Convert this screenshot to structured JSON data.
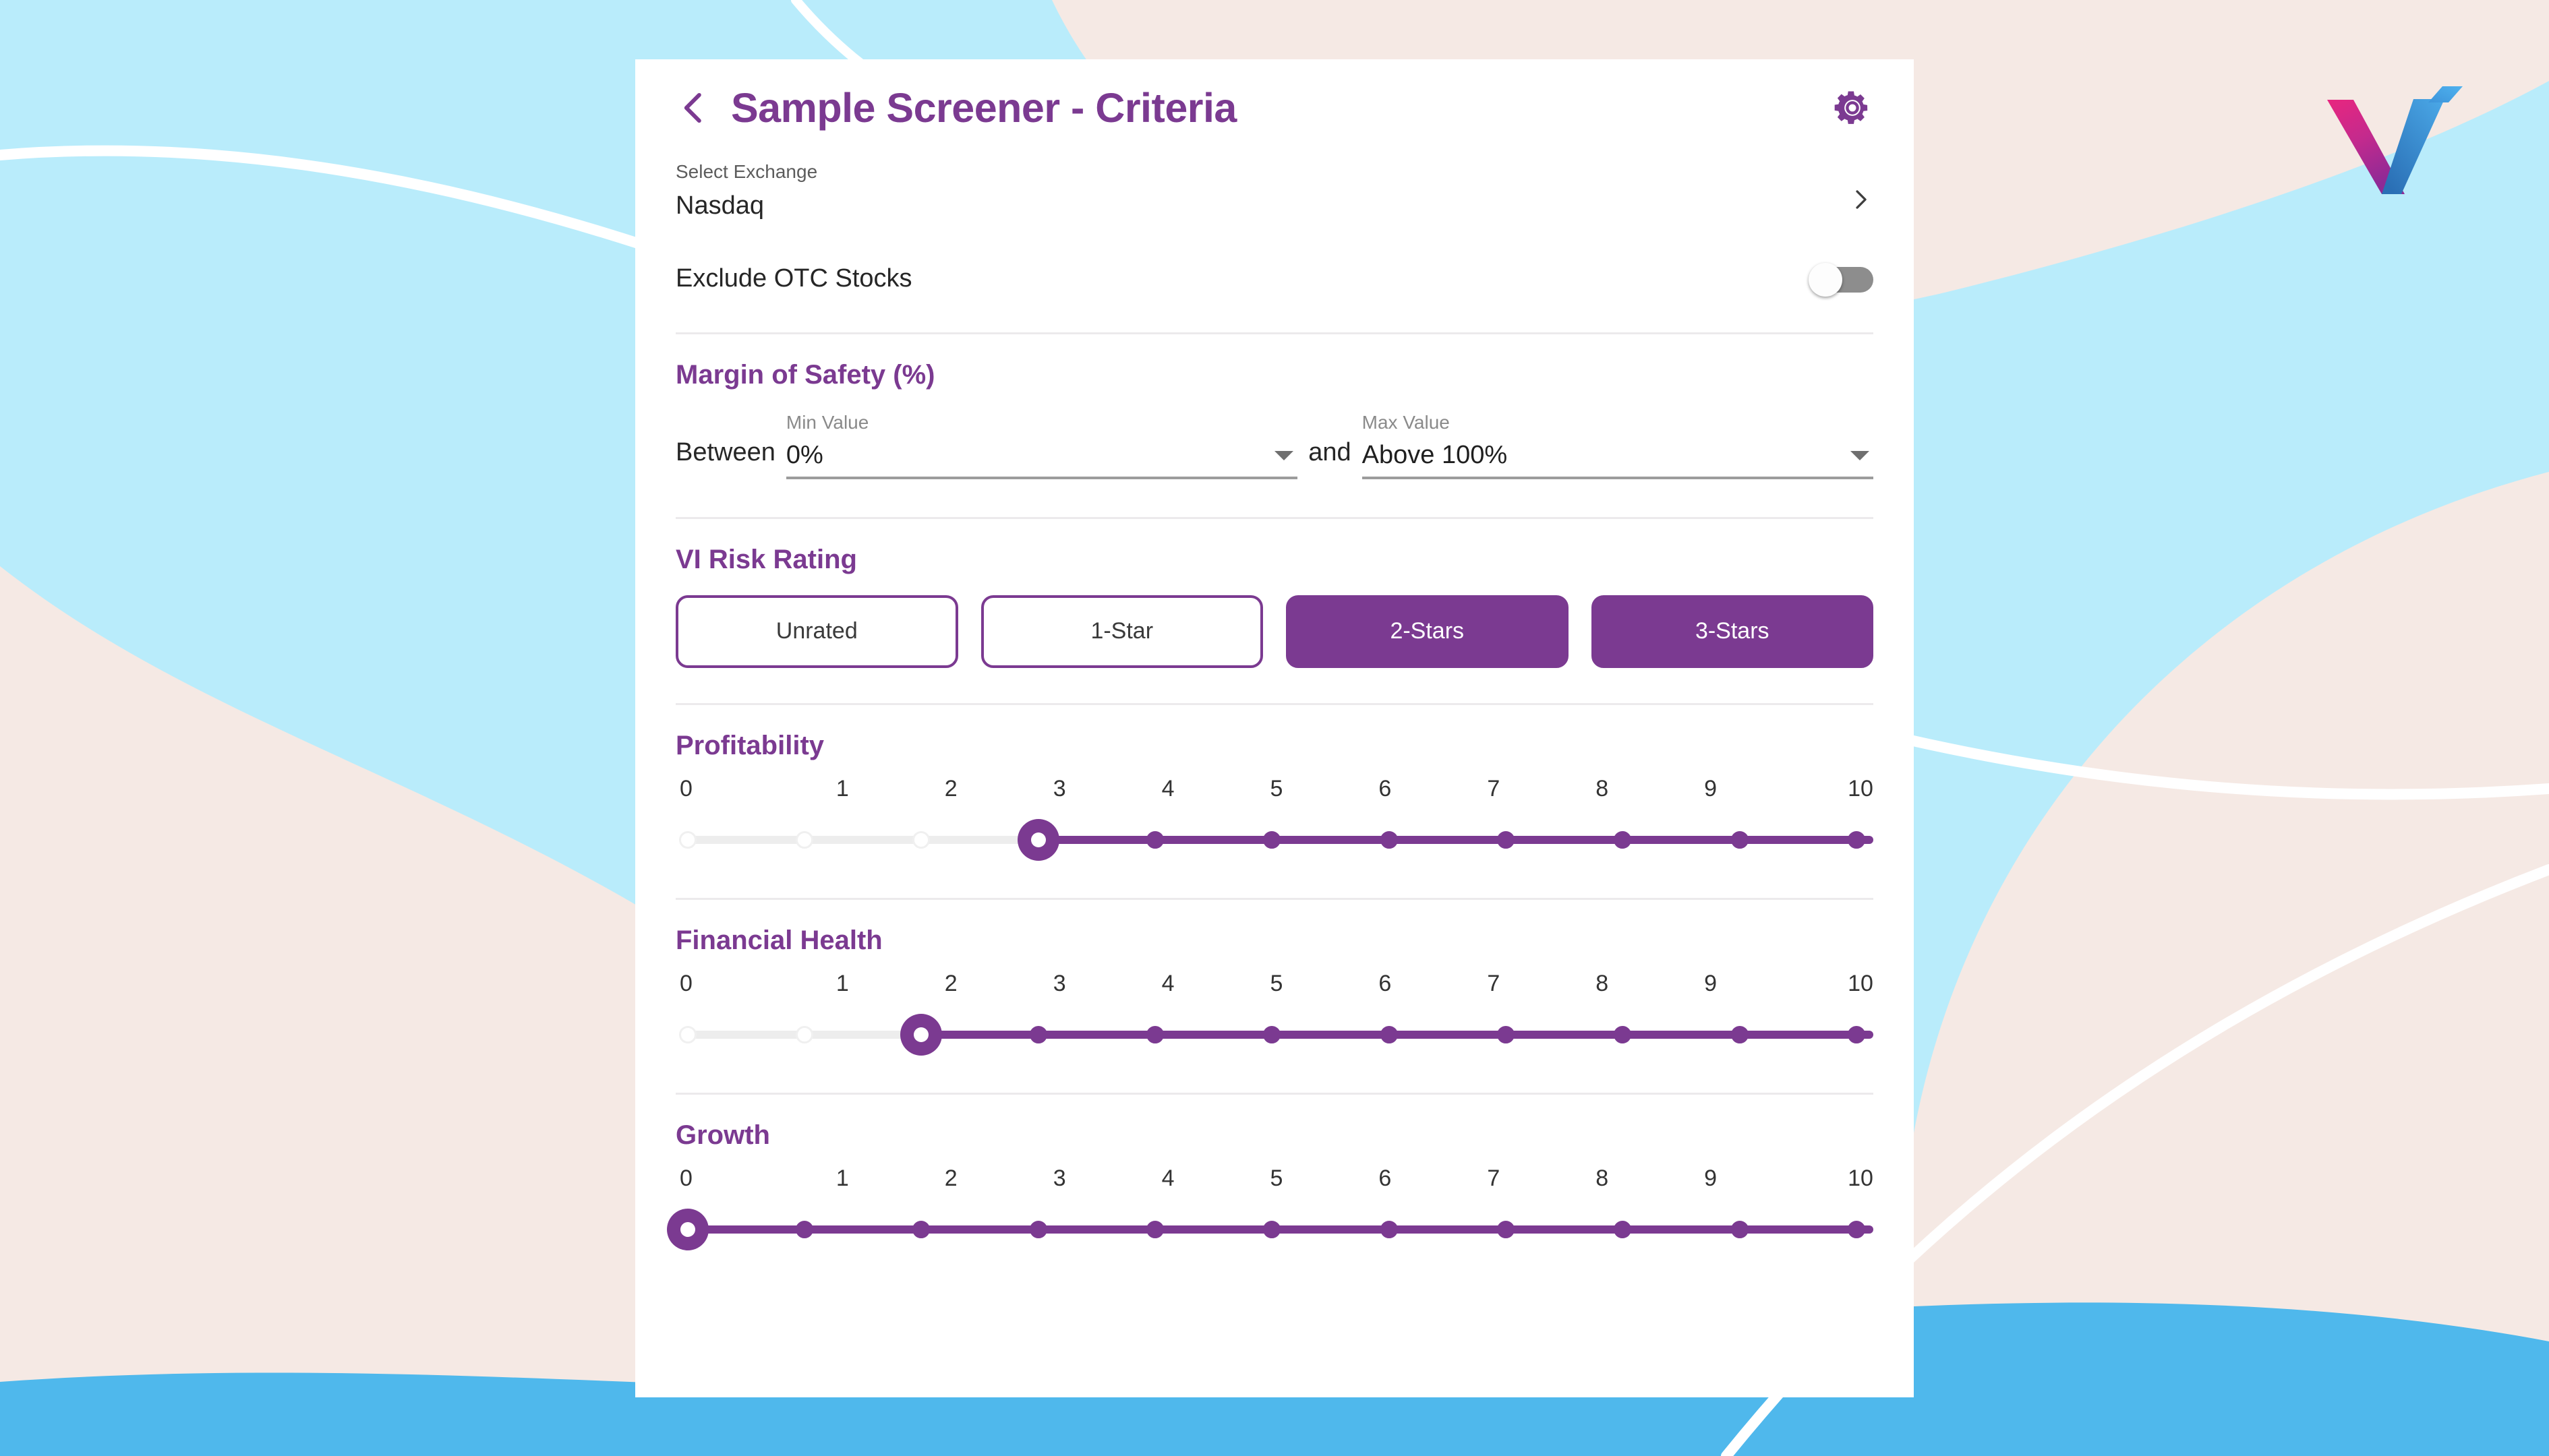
{
  "theme": {
    "accent_purple": "#7b3a91",
    "card_bg": "#ffffff",
    "bg_cyan": "#b9ecfb",
    "bg_blush": "#f5e9e4",
    "bg_blue": "#4fb8ec",
    "toggle_off_track": "#8d8d8d",
    "rail_inactive": "#ededed",
    "divider": "#eceaec"
  },
  "header": {
    "back_icon": "chevron-left-icon",
    "title": "Sample Screener - Criteria",
    "settings_icon": "gear-icon"
  },
  "exchange": {
    "caption": "Select Exchange",
    "value": "Nasdaq",
    "chevron_icon": "chevron-right-icon"
  },
  "otc": {
    "label": "Exclude OTC Stocks",
    "toggle_state": "off"
  },
  "margin_of_safety": {
    "title": "Margin of Safety (%)",
    "between_label": "Between",
    "and_label": "and",
    "min": {
      "caption": "Min Value",
      "value": "0%",
      "caret_icon": "caret-down-icon"
    },
    "max": {
      "caption": "Max Value",
      "value": "Above 100%",
      "caret_icon": "caret-down-icon"
    }
  },
  "risk_rating": {
    "title": "VI Risk Rating",
    "options": [
      {
        "label": "Unrated",
        "selected": false
      },
      {
        "label": "1-Star",
        "selected": false
      },
      {
        "label": "2-Stars",
        "selected": true
      },
      {
        "label": "3-Stars",
        "selected": true
      }
    ]
  },
  "sliders": [
    {
      "title": "Profitability",
      "ticks": [
        "0",
        "1",
        "2",
        "3",
        "4",
        "5",
        "6",
        "7",
        "8",
        "9",
        "10"
      ],
      "min": 0,
      "max": 10,
      "value": 3
    },
    {
      "title": "Financial Health",
      "ticks": [
        "0",
        "1",
        "2",
        "3",
        "4",
        "5",
        "6",
        "7",
        "8",
        "9",
        "10"
      ],
      "min": 0,
      "max": 10,
      "value": 2
    },
    {
      "title": "Growth",
      "ticks": [
        "0",
        "1",
        "2",
        "3",
        "4",
        "5",
        "6",
        "7",
        "8",
        "9",
        "10"
      ],
      "min": 0,
      "max": 10,
      "value": 0
    }
  ],
  "logo": {
    "name": "vi-logo",
    "alt": "VI"
  }
}
